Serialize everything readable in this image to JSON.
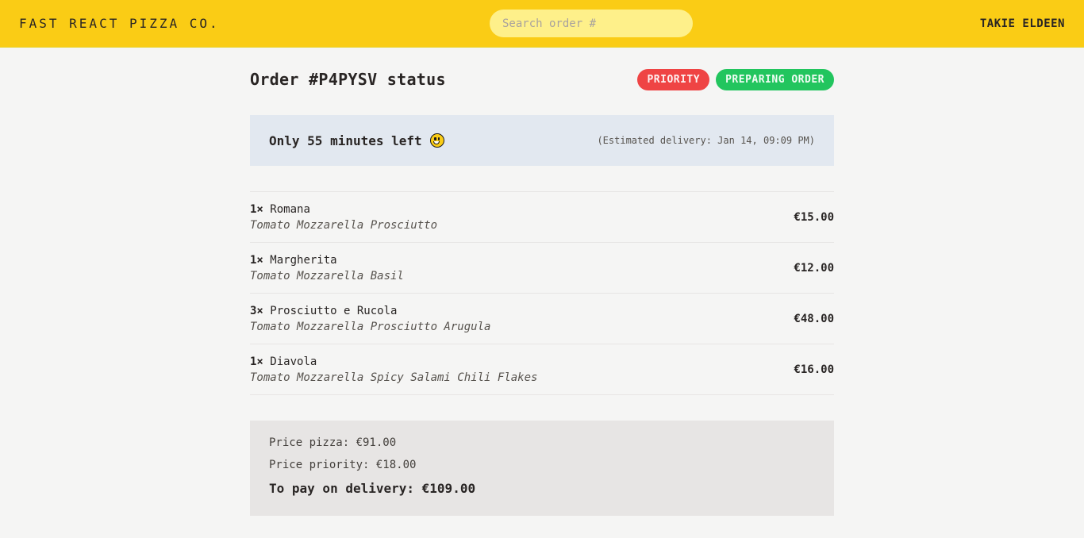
{
  "header": {
    "logo": "FAST REACT PIZZA CO.",
    "search_placeholder": "Search order #",
    "username": "TAKIE ELDEEN"
  },
  "order": {
    "title": "Order #P4PYSV status",
    "badges": {
      "priority": "PRIORITY",
      "status": "PREPARING ORDER"
    },
    "eta": {
      "text": "Only 55 minutes left",
      "emoji": "smiley-icon",
      "estimated": "(Estimated delivery: Jan 14, 09:09 PM)"
    },
    "items": [
      {
        "qty": "1×",
        "name": "Romana",
        "ingredients": "Tomato Mozzarella Prosciutto",
        "price": "€15.00"
      },
      {
        "qty": "1×",
        "name": "Margherita",
        "ingredients": "Tomato Mozzarella Basil",
        "price": "€12.00"
      },
      {
        "qty": "3×",
        "name": "Prosciutto e Rucola",
        "ingredients": "Tomato Mozzarella Prosciutto Arugula",
        "price": "€48.00"
      },
      {
        "qty": "1×",
        "name": "Diavola",
        "ingredients": "Tomato Mozzarella Spicy Salami Chili Flakes",
        "price": "€16.00"
      }
    ],
    "totals": {
      "price_pizza": "Price pizza: €91.00",
      "price_priority": "Price priority: €18.00",
      "to_pay": "To pay on delivery: €109.00"
    }
  },
  "colors": {
    "header_bg": "#facc15",
    "priority_badge": "#ef4444",
    "status_badge": "#22c55e",
    "eta_bg": "#e2e8f0",
    "totals_bg": "#e7e5e4"
  }
}
